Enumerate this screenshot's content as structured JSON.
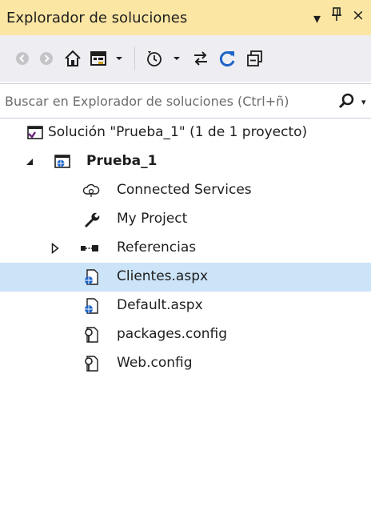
{
  "panel": {
    "title": "Explorador de soluciones",
    "dropdown_glyph": "▾",
    "pin_glyph": "Ч",
    "close_glyph": "×"
  },
  "toolbar": {
    "items": [
      {
        "name": "back-button",
        "icon": "back-arrow-icon"
      },
      {
        "name": "forward-button",
        "icon": "forward-arrow-icon"
      },
      {
        "name": "home-button",
        "icon": "home-icon"
      },
      {
        "name": "switch-views-button",
        "icon": "solution-folder-icon"
      },
      {
        "name": "pending-changes-filter-button",
        "icon": "history-clock-icon"
      },
      {
        "name": "sync-active-document-button",
        "icon": "sync-arrows-icon"
      },
      {
        "name": "refresh-button",
        "icon": "refresh-icon"
      },
      {
        "name": "collapse-all-button",
        "icon": "collapse-all-icon"
      }
    ]
  },
  "search": {
    "placeholder": "Buscar en Explorador de soluciones (Ctrl+ñ)"
  },
  "tree": {
    "solution": "Solución \"Prueba_1\" (1 de 1 proyecto)",
    "project": "Prueba_1",
    "connected_services": "Connected Services",
    "my_project": "My Project",
    "references": "Referencias",
    "clientes": "Clientes.aspx",
    "default": "Default.aspx",
    "packages": "packages.config",
    "webconfig": "Web.config"
  },
  "colors": {
    "title_bar": "#fce6a4",
    "toolbar": "#eeeef2",
    "selection": "#cce4f7",
    "refresh_blue": "#1e64c8"
  }
}
